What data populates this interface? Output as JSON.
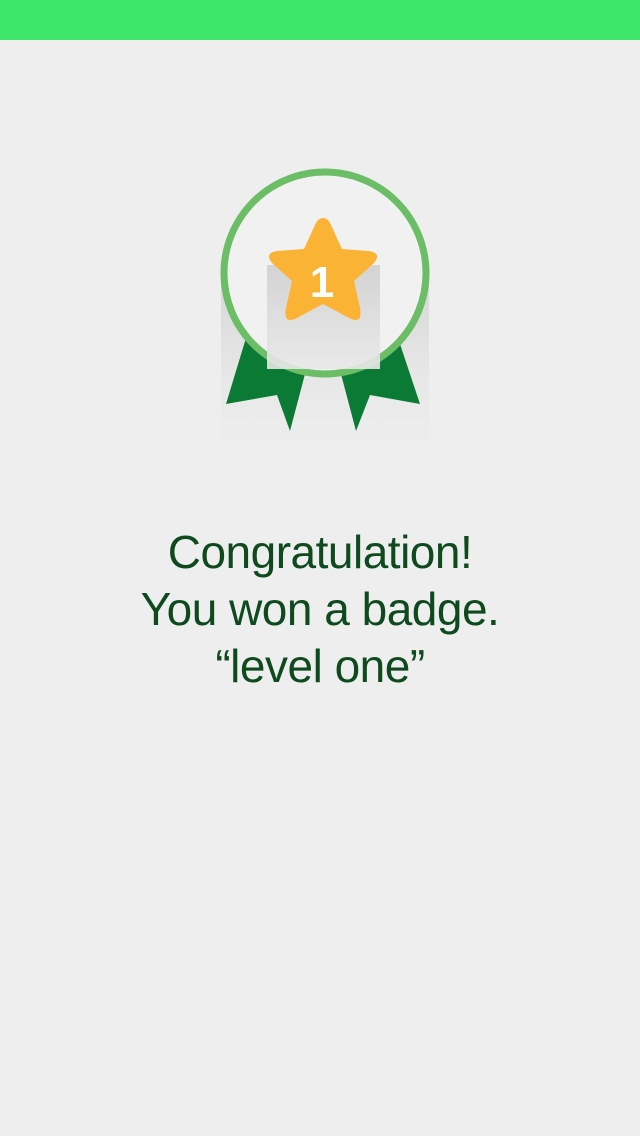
{
  "colors": {
    "status_bar": "#3ee66a",
    "background": "#eeeeee",
    "ring": "#6bbd66",
    "ribbon": "#0a7a34",
    "star": "#fbb335",
    "text": "#0f4a1f"
  },
  "badge": {
    "number": "1",
    "icons": [
      "medal-icon",
      "star-icon",
      "ribbon-icon"
    ]
  },
  "message": {
    "line1": "Congratulation!",
    "line2": "You won a badge.",
    "line3": "“level one”"
  }
}
